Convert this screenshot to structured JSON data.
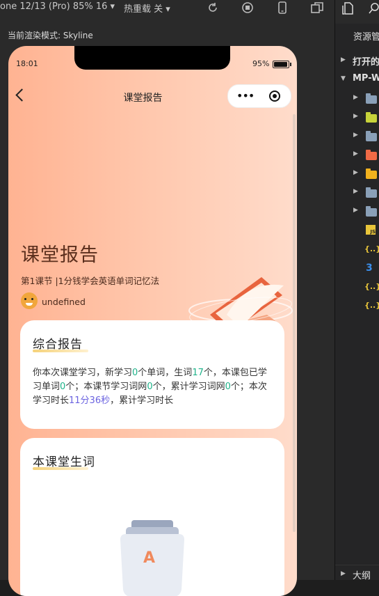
{
  "toolbar": {
    "device_select": "one 12/13 (Pro) 85% 16",
    "hot_reload_select": "热重载 关"
  },
  "render_mode": "当前渲染模式: Skyline",
  "right_panel": {
    "resource_manager": "资源管",
    "open_editors": "打开的",
    "project": "MP-W",
    "outline": "大纲"
  },
  "status_bar": {
    "time": "18:01",
    "battery": "95%"
  },
  "nav": {
    "title": "课堂报告",
    "more_icon": "•••",
    "close_icon": "record-icon"
  },
  "hero": {
    "title": "课堂报告",
    "lesson": "第1课节",
    "separator": "|",
    "lesson_name": "1分钱学会英语单词记忆法",
    "user_name": "undefined"
  },
  "report_card": {
    "title": "综合报告",
    "text_1": "你本次课堂学习，新学习",
    "new_words": "0",
    "text_2": "个单词，生词",
    "unknown_words": "17",
    "text_3": "个，本课包已学习单词",
    "package_words": "0",
    "text_4": "个；本课节学习词网",
    "lesson_nets": "0",
    "text_5": "个，累计学习词网",
    "total_nets": "0",
    "text_6": "个；本次学习时长",
    "duration": "11分36秒",
    "text_7": "，累计学习时长"
  },
  "vocab_card": {
    "title": "本课堂生词",
    "empty_letter": "A"
  },
  "colors": {
    "accent_green": "#1fb38a",
    "accent_purple": "#6b63e0",
    "hero_brown": "#5a2e1c"
  }
}
